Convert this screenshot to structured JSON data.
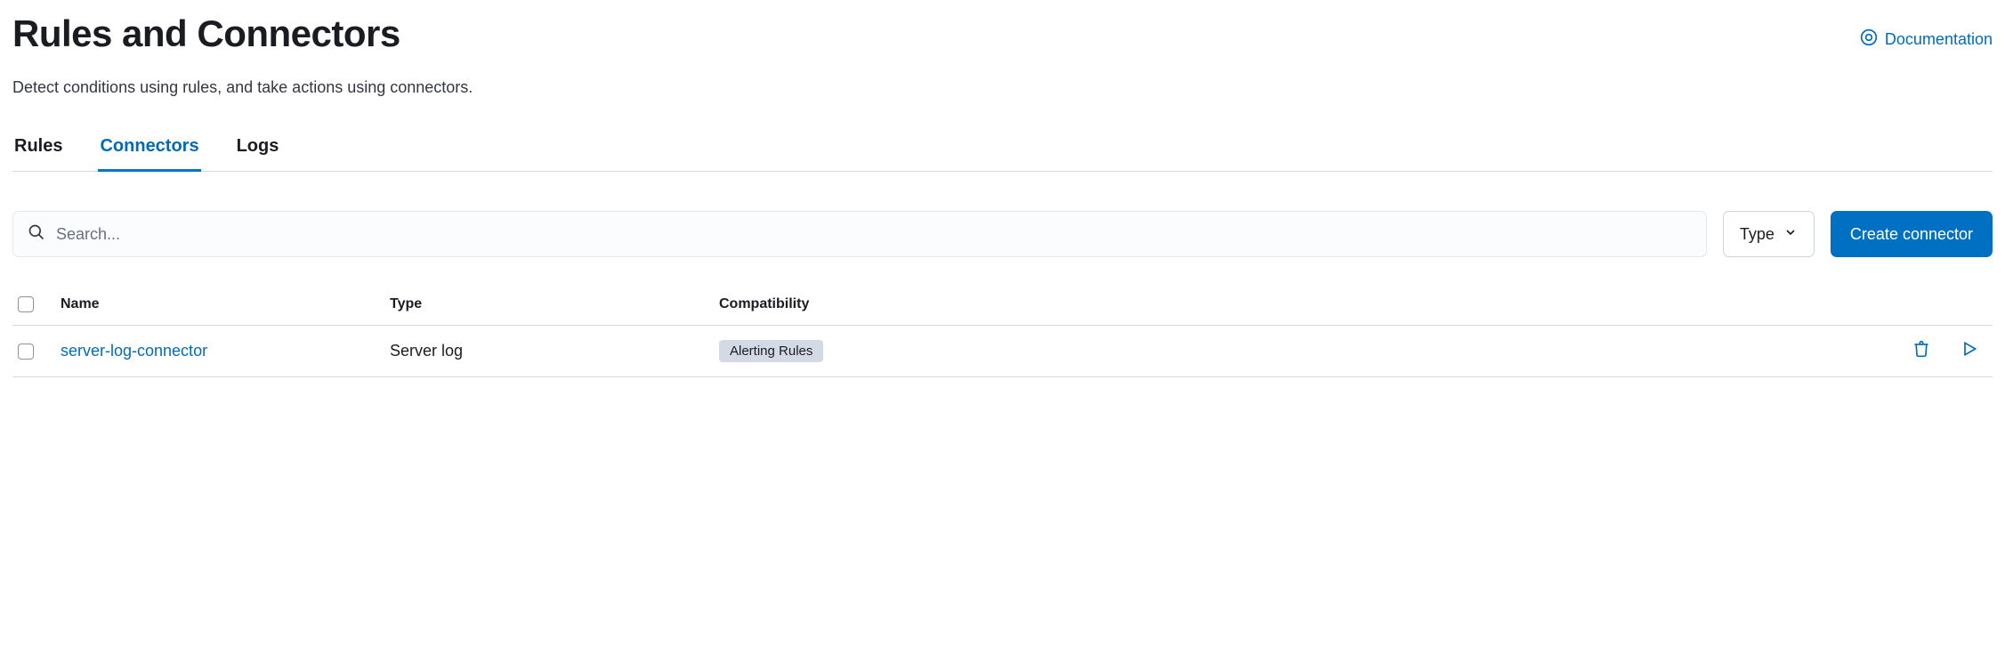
{
  "header": {
    "title": "Rules and Connectors",
    "doc_link": "Documentation",
    "subtitle": "Detect conditions using rules, and take actions using connectors."
  },
  "tabs": [
    {
      "label": "Rules",
      "active": false
    },
    {
      "label": "Connectors",
      "active": true
    },
    {
      "label": "Logs",
      "active": false
    }
  ],
  "toolbar": {
    "search_placeholder": "Search...",
    "type_filter_label": "Type",
    "create_button": "Create connector"
  },
  "table": {
    "columns": {
      "name": "Name",
      "type": "Type",
      "compatibility": "Compatibility"
    },
    "rows": [
      {
        "name": "server-log-connector",
        "type": "Server log",
        "compatibility": "Alerting Rules"
      }
    ]
  }
}
